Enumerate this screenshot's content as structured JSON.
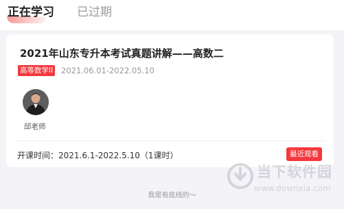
{
  "tabs": {
    "active_label": "正在学习",
    "inactive_label": "已过期"
  },
  "course": {
    "title": "2021年山东专升本考试真题讲解——高数二",
    "subject_tag": "高等数学II",
    "dates": "2021.06.01-2022.05.10",
    "teacher_name": "邱老师",
    "schedule": "开课时间：2021.6.1-2022.5.10（1课时）",
    "recent_button": "最近观看"
  },
  "footer": {
    "end_text": "我是有底线的～"
  },
  "watermark": {
    "title": "当下软件园",
    "url": "www.downxia.com"
  },
  "colors": {
    "accent": "#f4383c",
    "background": "#f3f3f8"
  }
}
